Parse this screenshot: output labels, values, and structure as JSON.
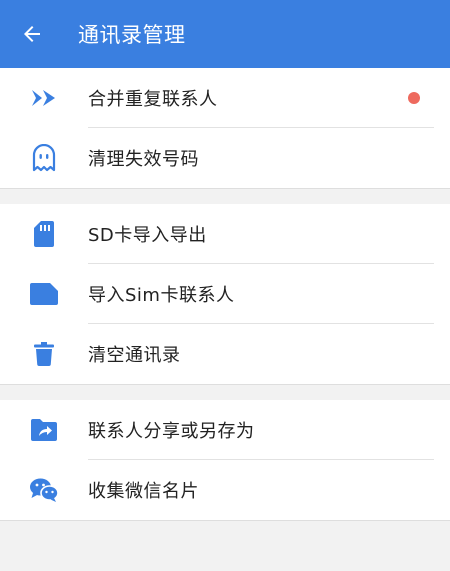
{
  "header": {
    "title": "通讯录管理",
    "back_icon": "back-arrow-icon",
    "background": "#3a7fe0"
  },
  "accent": "#3a7fe0",
  "badge_color": "#ee6a5e",
  "groups": [
    {
      "items": [
        {
          "label": "合并重复联系人",
          "icon": "merge-arrows-icon",
          "has_badge": true
        },
        {
          "label": "清理失效号码",
          "icon": "ghost-icon",
          "has_badge": false
        }
      ]
    },
    {
      "items": [
        {
          "label": "SD卡导入导出",
          "icon": "sd-card-icon",
          "has_badge": false
        },
        {
          "label": "导入Sim卡联系人",
          "icon": "sim-card-icon",
          "has_badge": false
        },
        {
          "label": "清空通讯录",
          "icon": "trash-icon",
          "has_badge": false
        }
      ]
    },
    {
      "items": [
        {
          "label": "联系人分享或另存为",
          "icon": "share-folder-icon",
          "has_badge": false
        },
        {
          "label": "收集微信名片",
          "icon": "wechat-icon",
          "has_badge": false
        }
      ]
    }
  ]
}
